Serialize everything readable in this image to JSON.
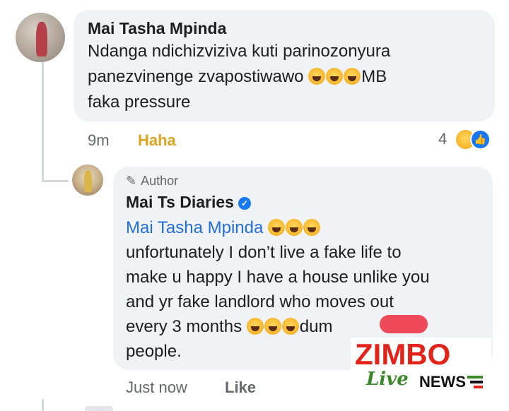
{
  "comment": {
    "author": "Mai Tasha Mpinda",
    "line1": "Ndanga ndichizviziva kuti parinozonyura",
    "line2_text": "panezvinenge zvapostiwawo",
    "line2_suffix": "MB",
    "line3": "faka pressure",
    "time": "9m",
    "reaction_label": "Haha",
    "reaction_count": "4"
  },
  "reply": {
    "badge": "Author",
    "author": "Mai Ts Diaries",
    "mention": "Mai Tasha Mpinda",
    "line1": "unfortunately I don’t live a fake life to",
    "line2": "make u happy I have a house unlike you",
    "line3": "and yr fake landlord who moves out",
    "line4_text": "every 3 months",
    "line4_suffix": "dum",
    "line5": "people.",
    "time": "Just now",
    "action": "Like"
  },
  "watermark": {
    "brand": "ZIMBO",
    "sub1": "Live",
    "sub2": "NEWS"
  },
  "icons": {
    "emoji": "laughing-tears-emoji",
    "verified": "verified-badge-icon",
    "author": "pencil-icon"
  },
  "colors": {
    "bubble": "#f0f2f5",
    "mention": "#216fdb",
    "haha": "#d9a21f",
    "verified": "#1877f2",
    "brand_red": "#e2231a",
    "brand_green": "#3a8a2a"
  }
}
